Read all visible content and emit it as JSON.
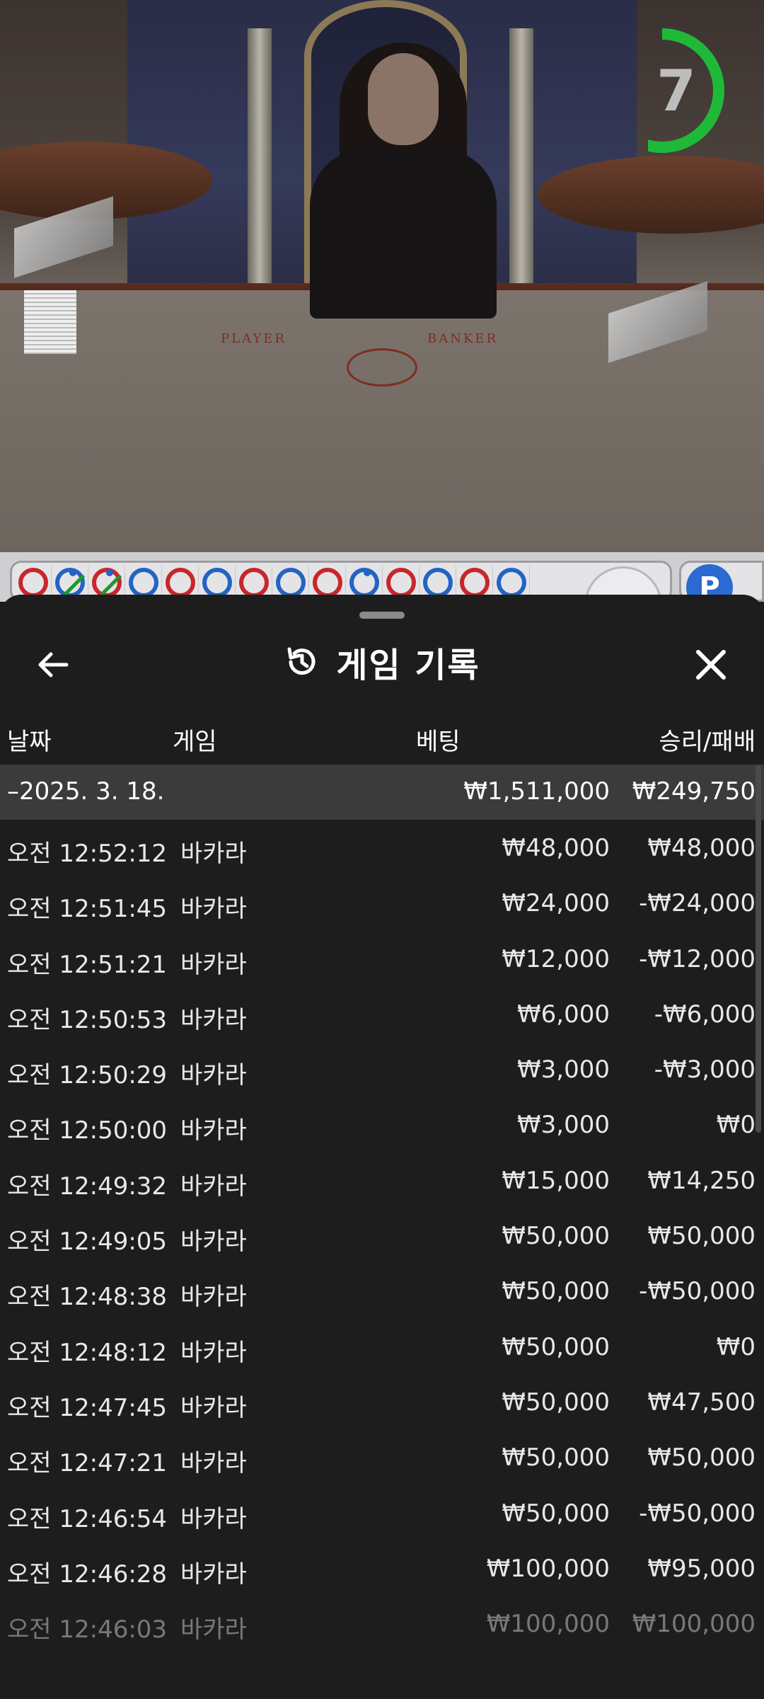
{
  "timer": {
    "seconds": "7",
    "progress": 0.55,
    "color": "#1fb93a"
  },
  "bead_road": [
    {
      "color": "red"
    },
    {
      "color": "blue",
      "tie": true,
      "dot": true
    },
    {
      "color": "red",
      "tie": true,
      "dot": true
    },
    {
      "color": "blue"
    },
    {
      "color": "red"
    },
    {
      "color": "blue"
    },
    {
      "color": "red"
    },
    {
      "color": "blue"
    },
    {
      "color": "red"
    },
    {
      "color": "blue",
      "dot": true
    },
    {
      "color": "red"
    },
    {
      "color": "blue"
    },
    {
      "color": "red"
    },
    {
      "color": "blue"
    }
  ],
  "side_badge": "P",
  "history": {
    "title": "게임 기록",
    "back_icon": "arrow-left-icon",
    "close_icon": "close-icon",
    "title_icon": "history-icon",
    "columns": {
      "date": "날짜",
      "game": "게임",
      "bet": "베팅",
      "win_loss": "승리/패배"
    },
    "group": {
      "date": "–2025. 3. 18.",
      "bet_total": "₩1,511,000",
      "win_total": "₩249,750"
    },
    "rows": [
      {
        "time": "오전 12:52:12",
        "game": "바카라",
        "bet": "₩48,000",
        "result": "₩48,000"
      },
      {
        "time": "오전 12:51:45",
        "game": "바카라",
        "bet": "₩24,000",
        "result": "-₩24,000"
      },
      {
        "time": "오전 12:51:21",
        "game": "바카라",
        "bet": "₩12,000",
        "result": "-₩12,000"
      },
      {
        "time": "오전 12:50:53",
        "game": "바카라",
        "bet": "₩6,000",
        "result": "-₩6,000"
      },
      {
        "time": "오전 12:50:29",
        "game": "바카라",
        "bet": "₩3,000",
        "result": "-₩3,000"
      },
      {
        "time": "오전 12:50:00",
        "game": "바카라",
        "bet": "₩3,000",
        "result": "₩0"
      },
      {
        "time": "오전 12:49:32",
        "game": "바카라",
        "bet": "₩15,000",
        "result": "₩14,250"
      },
      {
        "time": "오전 12:49:05",
        "game": "바카라",
        "bet": "₩50,000",
        "result": "₩50,000"
      },
      {
        "time": "오전 12:48:38",
        "game": "바카라",
        "bet": "₩50,000",
        "result": "-₩50,000"
      },
      {
        "time": "오전 12:48:12",
        "game": "바카라",
        "bet": "₩50,000",
        "result": "₩0"
      },
      {
        "time": "오전 12:47:45",
        "game": "바카라",
        "bet": "₩50,000",
        "result": "₩47,500"
      },
      {
        "time": "오전 12:47:21",
        "game": "바카라",
        "bet": "₩50,000",
        "result": "₩50,000"
      },
      {
        "time": "오전 12:46:54",
        "game": "바카라",
        "bet": "₩50,000",
        "result": "-₩50,000"
      },
      {
        "time": "오전 12:46:28",
        "game": "바카라",
        "bet": "₩100,000",
        "result": "₩95,000"
      },
      {
        "time": "오전 12:46:03",
        "game": "바카라",
        "bet": "₩100,000",
        "result": "₩100,000"
      }
    ]
  }
}
